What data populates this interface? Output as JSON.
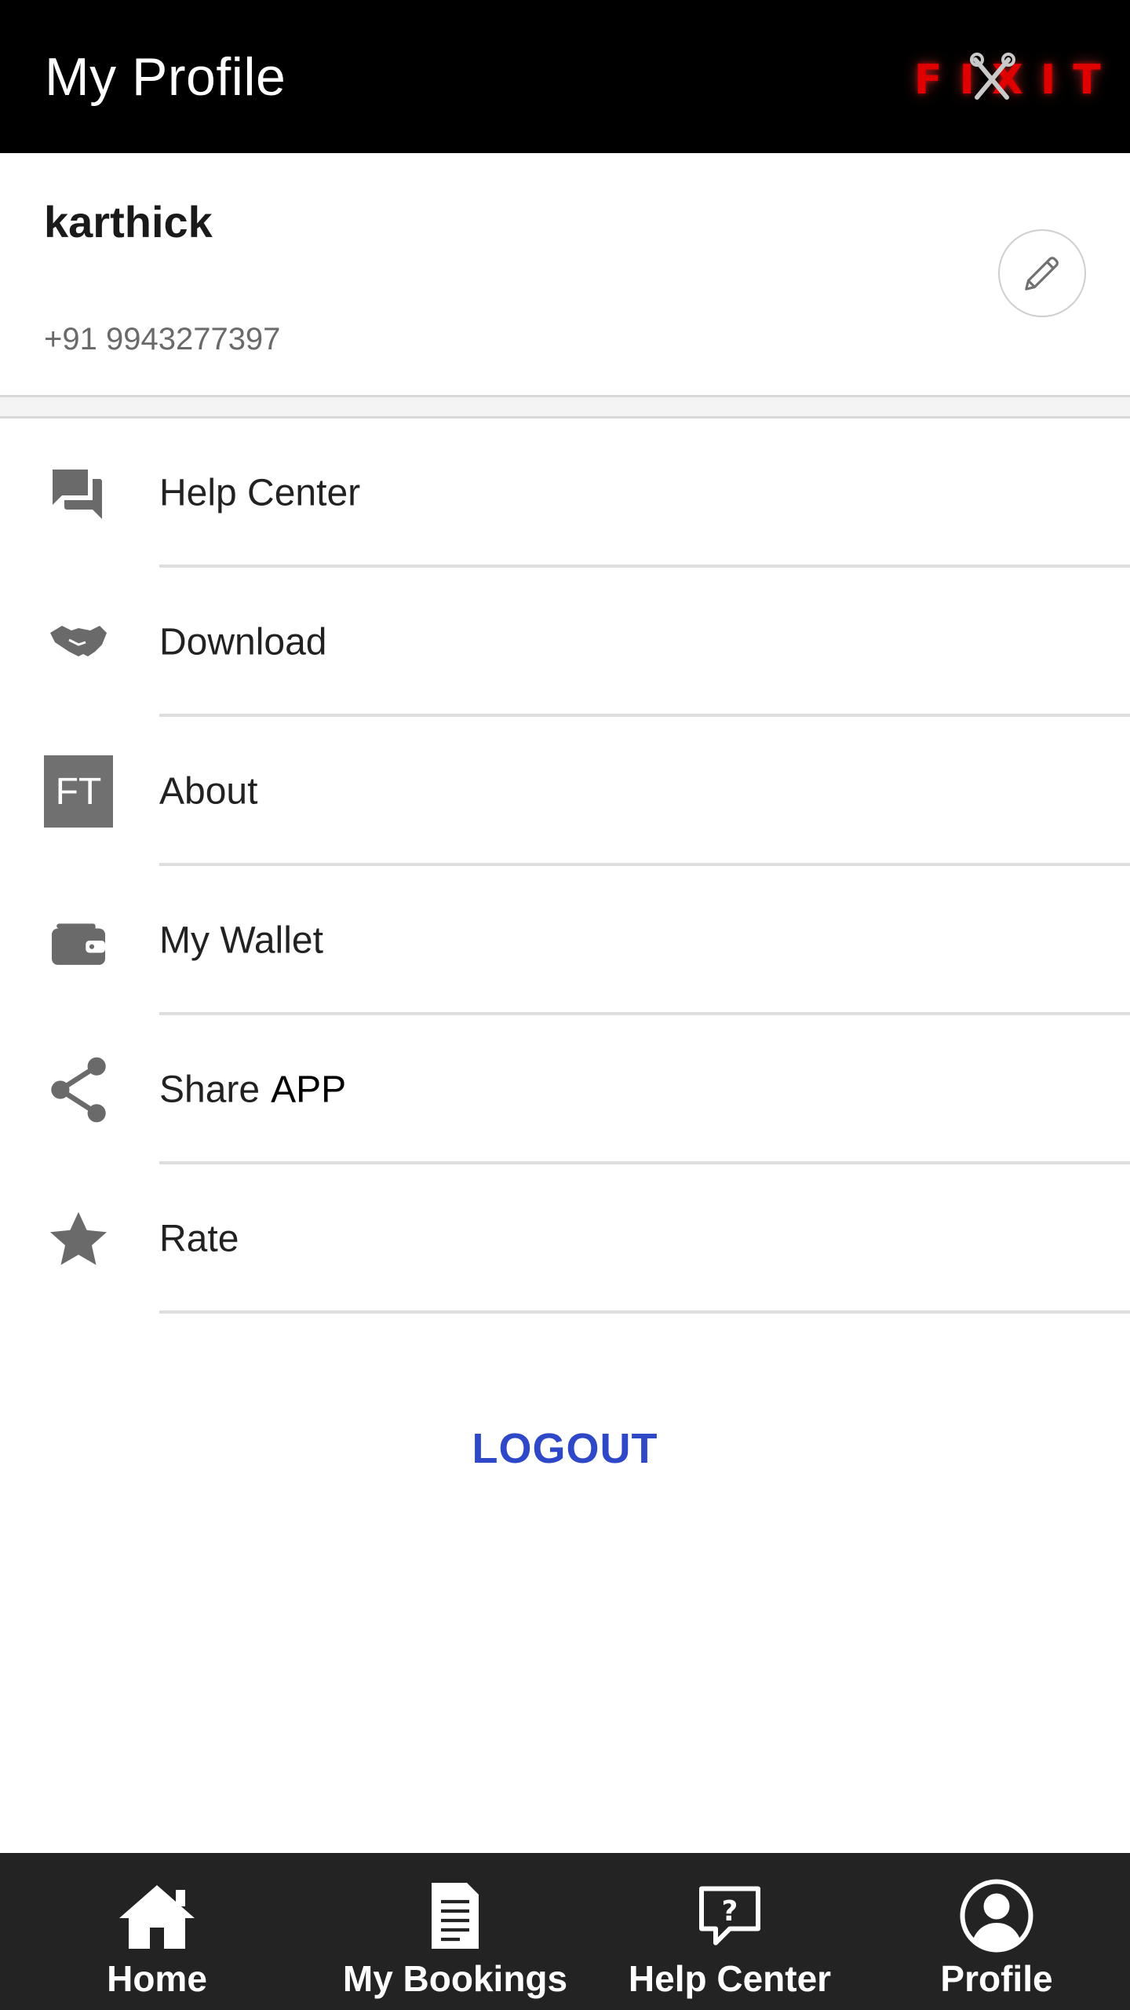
{
  "header": {
    "title": "My Profile",
    "brand": "FIXIT",
    "background": "#000000"
  },
  "profile": {
    "name": "karthick",
    "phone": "+91 9943277397",
    "edit_icon": "pencil-icon"
  },
  "menu": {
    "items": [
      {
        "label": "Help Center",
        "icon": "chat-bubbles-icon"
      },
      {
        "label": "Download",
        "icon": "handshake-icon"
      },
      {
        "label": "About",
        "icon": "ft-logo-icon",
        "badge": "FT"
      },
      {
        "label": "My Wallet",
        "icon": "wallet-icon"
      },
      {
        "label": "Share",
        "suffix": "APP",
        "icon": "share-icon"
      },
      {
        "label": "Rate",
        "icon": "star-icon"
      }
    ]
  },
  "logout": {
    "label": "LOGOUT",
    "color": "#2f48c8"
  },
  "bottom_nav": {
    "items": [
      {
        "label": "Home",
        "icon": "home-icon"
      },
      {
        "label": "My Bookings",
        "icon": "document-icon"
      },
      {
        "label": "Help Center",
        "icon": "help-bubble-icon"
      },
      {
        "label": "Profile",
        "icon": "user-circle-icon"
      }
    ],
    "background": "#232323"
  }
}
